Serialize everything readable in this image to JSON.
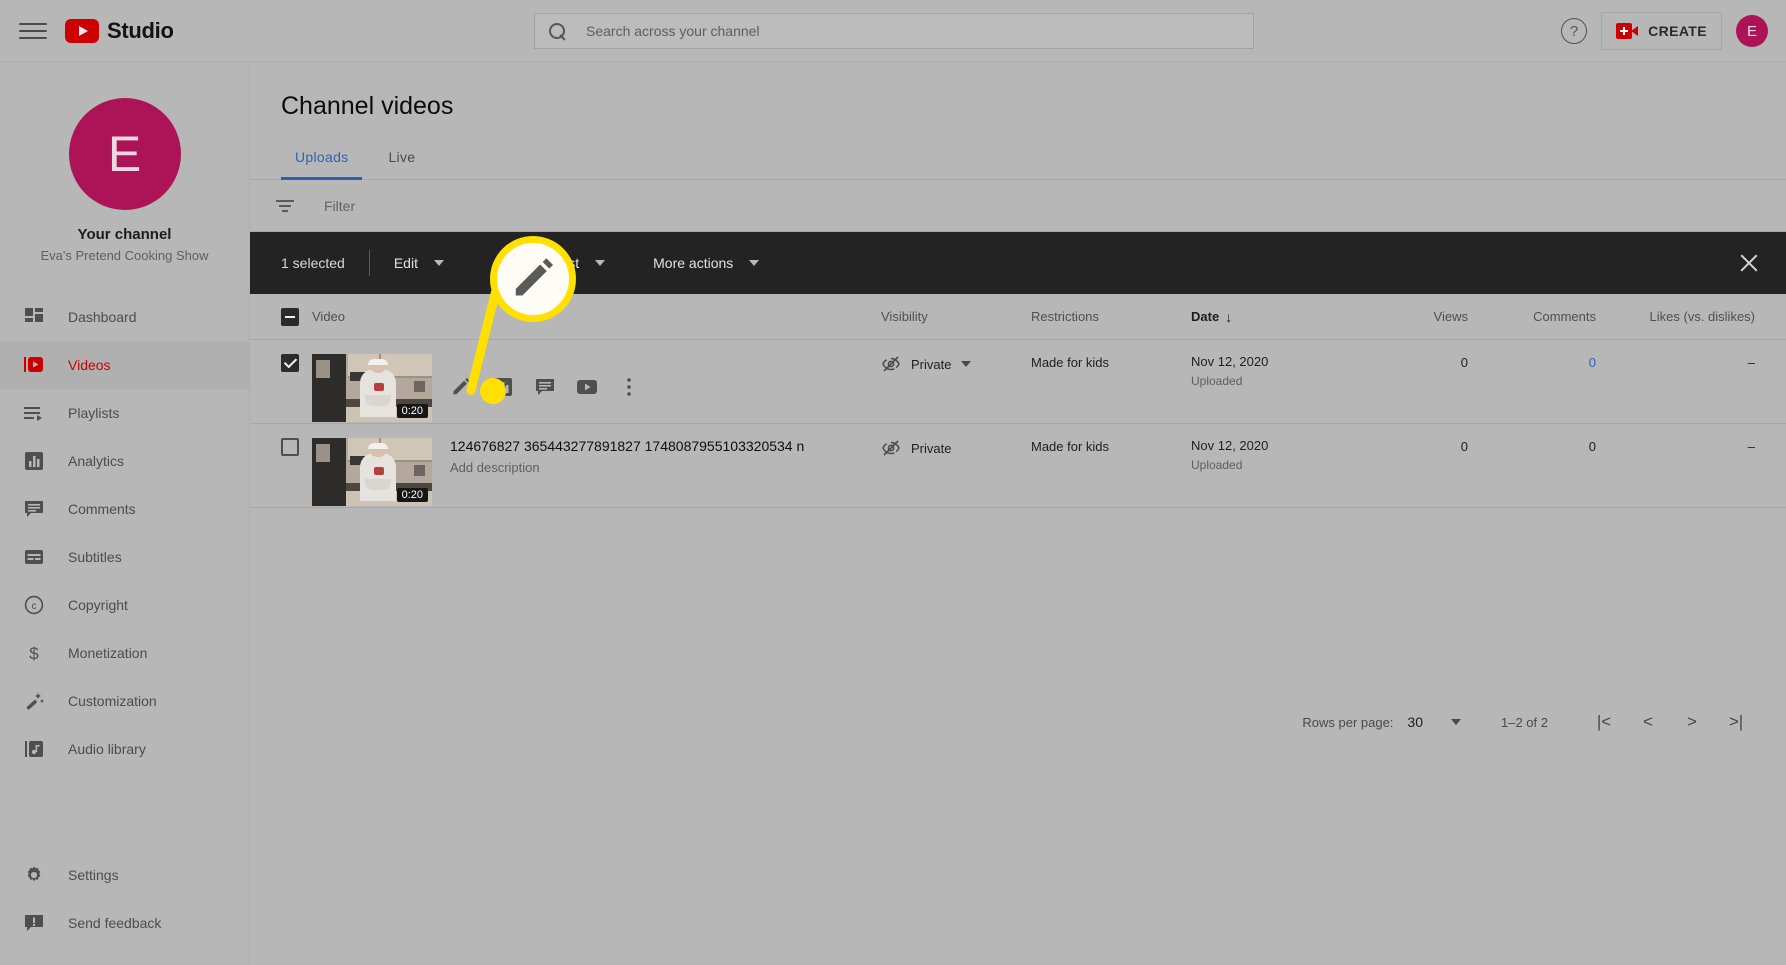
{
  "header": {
    "menu_icon": "hamburger-icon",
    "logo_text": "Studio",
    "search": {
      "placeholder": "Search across your channel",
      "value": "",
      "icon": "search-icon"
    },
    "help_icon": "help-icon",
    "create_label": "CREATE",
    "create_icon": "video-camera-plus-icon",
    "avatar_initial": "E"
  },
  "sidebar": {
    "avatar_initial": "E",
    "channel_title": "Your channel",
    "channel_name": "Eva's Pretend Cooking Show",
    "items": [
      {
        "label": "Dashboard",
        "icon": "dashboard-icon",
        "active": false
      },
      {
        "label": "Videos",
        "icon": "videos-icon",
        "active": true
      },
      {
        "label": "Playlists",
        "icon": "playlists-icon",
        "active": false
      },
      {
        "label": "Analytics",
        "icon": "analytics-icon",
        "active": false
      },
      {
        "label": "Comments",
        "icon": "comments-icon",
        "active": false
      },
      {
        "label": "Subtitles",
        "icon": "subtitles-icon",
        "active": false
      },
      {
        "label": "Copyright",
        "icon": "copyright-icon",
        "active": false
      },
      {
        "label": "Monetization",
        "icon": "dollar-icon",
        "active": false
      },
      {
        "label": "Customization",
        "icon": "magic-wand-icon",
        "active": false
      },
      {
        "label": "Audio library",
        "icon": "audio-library-icon",
        "active": false
      }
    ],
    "bottom_items": [
      {
        "label": "Settings",
        "icon": "gear-icon"
      },
      {
        "label": "Send feedback",
        "icon": "feedback-icon"
      }
    ]
  },
  "main": {
    "page_title": "Channel videos",
    "tabs": [
      {
        "label": "Uploads",
        "active": true
      },
      {
        "label": "Live",
        "active": false
      }
    ],
    "filter": {
      "placeholder": "Filter",
      "icon": "filter-icon"
    }
  },
  "selection_toolbar": {
    "count_label": "1 selected",
    "actions": [
      {
        "label": "Edit",
        "caret": true
      },
      {
        "label": "Add to playlist",
        "caret": true
      },
      {
        "label": "More actions",
        "caret": true
      }
    ],
    "close_icon": "close-icon"
  },
  "table": {
    "headers": {
      "video": "Video",
      "visibility": "Visibility",
      "restrictions": "Restrictions",
      "date": "Date",
      "date_sort_arrow": "↓",
      "views": "Views",
      "comments": "Comments",
      "likes": "Likes (vs. dislikes)"
    },
    "select_all_state": "indeterminate",
    "rows": [
      {
        "selected": true,
        "duration": "0:20",
        "title": "",
        "description": "",
        "show_hover_actions": true,
        "hover_actions": [
          "edit-pencil-icon",
          "analytics-icon",
          "comments-icon",
          "youtube-play-icon",
          "more-vertical-icon"
        ],
        "visibility": "Private",
        "visibility_icon": "eye-off-icon",
        "visibility_has_dropdown": true,
        "restrictions": "Made for kids",
        "date": "Nov 12, 2020",
        "date_sub": "Uploaded",
        "views": "0",
        "comments": "0",
        "comments_is_link": true,
        "likes": "–"
      },
      {
        "selected": false,
        "duration": "0:20",
        "title": "124676827 365443277891827 1748087955103320534 n",
        "description": "Add description",
        "show_hover_actions": false,
        "hover_actions": [],
        "visibility": "Private",
        "visibility_icon": "eye-off-icon",
        "visibility_has_dropdown": false,
        "restrictions": "Made for kids",
        "date": "Nov 12, 2020",
        "date_sub": "Uploaded",
        "views": "0",
        "comments": "0",
        "comments_is_link": false,
        "likes": "–"
      }
    ]
  },
  "pagination": {
    "rows_per_page_label": "Rows per page:",
    "rows_per_page_value": "30",
    "range_label": "1–2 of 2",
    "first_icon": "|<",
    "prev_icon": "<",
    "next_icon": ">",
    "last_icon": ">|"
  },
  "annotation": {
    "magnified_icon": "edit-pencil-icon",
    "highlight_color": "#ffe000"
  }
}
